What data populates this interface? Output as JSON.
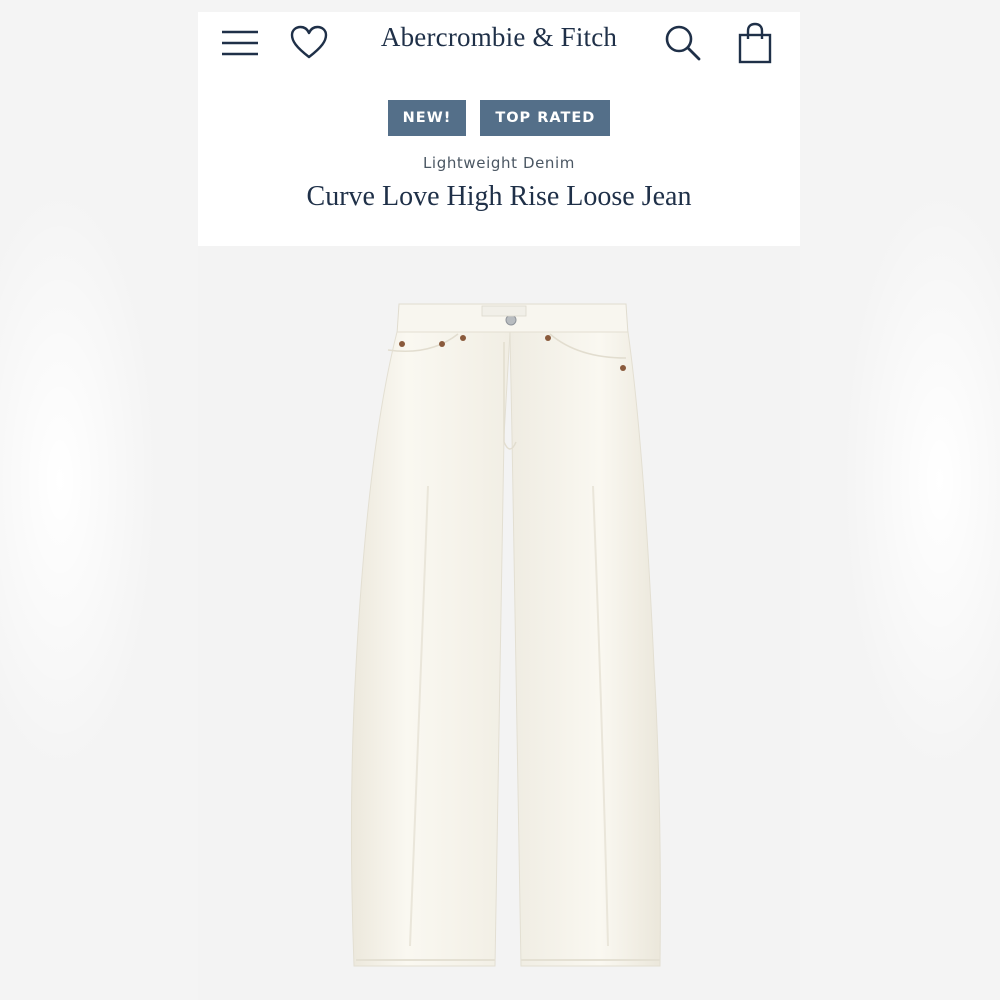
{
  "header": {
    "brand": "Abercrombie & Fitch",
    "icons": [
      "menu-icon",
      "heart-icon",
      "search-icon",
      "shopping-bag-icon"
    ]
  },
  "product": {
    "badges": [
      {
        "label": "NEW!"
      },
      {
        "label": "TOP RATED"
      }
    ],
    "category": "Lightweight Denim",
    "title": "Curve Love High Rise Loose Jean",
    "colors": {
      "brand_navy": "#1f3048",
      "badge_bg": "#546f89",
      "badge_text": "#ffffff"
    }
  }
}
